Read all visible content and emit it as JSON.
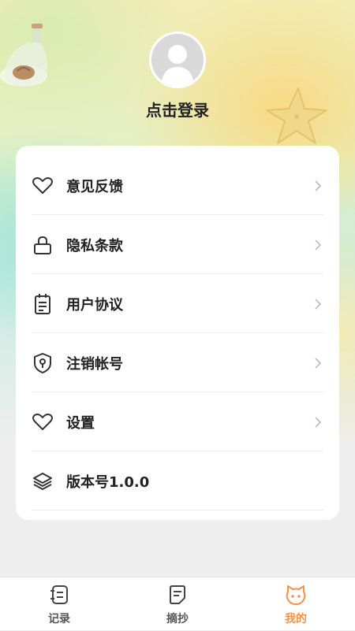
{
  "profile": {
    "login_label": "点击登录"
  },
  "menu": {
    "items": [
      {
        "label": "意见反馈",
        "icon": "heart-icon",
        "has_chevron": true
      },
      {
        "label": "隐私条款",
        "icon": "lock-icon",
        "has_chevron": true
      },
      {
        "label": "用户协议",
        "icon": "document-icon",
        "has_chevron": true
      },
      {
        "label": "注销帐号",
        "icon": "shield-icon",
        "has_chevron": true
      },
      {
        "label": "设置",
        "icon": "heart-icon",
        "has_chevron": true
      },
      {
        "label": "版本号1.0.0",
        "icon": "layers-icon",
        "has_chevron": false
      }
    ]
  },
  "tabbar": {
    "tabs": [
      {
        "label": "记录",
        "icon": "notebook-icon",
        "active": false
      },
      {
        "label": "摘抄",
        "icon": "note-icon",
        "active": false
      },
      {
        "label": "我的",
        "icon": "cat-face-icon",
        "active": true
      }
    ]
  },
  "colors": {
    "accent": "#f3924b",
    "text": "#222222",
    "icon": "#333333"
  }
}
